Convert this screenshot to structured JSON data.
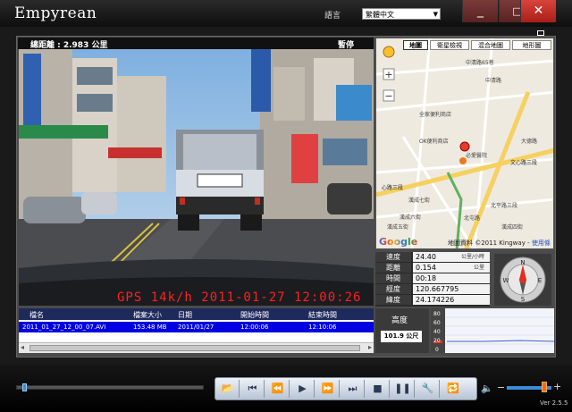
{
  "app": {
    "title": "Empyrean",
    "version": "Ver 2.5.5"
  },
  "language": {
    "label": "語言",
    "selected": "繁體中文"
  },
  "window": {
    "minimize": "_",
    "maximize": "□",
    "close": "✕"
  },
  "video": {
    "total_distance": "總距離 : 2.983 公里",
    "status": "暫停",
    "overlay": "GPS  14k/h  2011-01-27  12:00:26"
  },
  "filelist": {
    "columns": [
      "檔名",
      "檔案大小",
      "日期",
      "開始時間",
      "結束時間"
    ],
    "rows": [
      [
        "2011_01_27_12_00_07.AVI",
        "153.48 MB",
        "2011/01/27",
        "12:00:06",
        "12:10:06"
      ]
    ]
  },
  "map": {
    "tabs": [
      "地圖",
      "衛星檢視",
      "混合地圖",
      "地形圖"
    ],
    "active_tab": "地圖",
    "credit": "地圖資料 ©2011 Kingway -",
    "terms_link": "使用條款",
    "google": "Google",
    "labels": [
      "中清路65巷",
      "中清路",
      "全家便利商店",
      "OK便利商店",
      "大德路",
      "文心路三段",
      "必愛醫院",
      "心路三段",
      "漢成七街",
      "北屯路",
      "北平路三段",
      "漢成六街",
      "漢成五街",
      "漢成四街"
    ]
  },
  "info": {
    "rows": [
      {
        "label": "速度",
        "value": "24.40",
        "unit": "公里/小時"
      },
      {
        "label": "距離",
        "value": "0.154",
        "unit": "公里"
      },
      {
        "label": "時間",
        "value": "00:18",
        "unit": ""
      },
      {
        "label": "經度",
        "value": "120.667795",
        "unit": ""
      },
      {
        "label": "緯度",
        "value": "24.174226",
        "unit": ""
      }
    ]
  },
  "compass": {
    "n": "N",
    "s": "S",
    "e": "E",
    "w": "W"
  },
  "altitude": {
    "label": "高度",
    "value": "101.9 公尺",
    "ticks": [
      "80",
      "60",
      "40",
      "20",
      "0"
    ]
  },
  "playback": {
    "seek_fraction": 0.03,
    "volume_fraction": 0.78
  },
  "colors": {
    "accent": "#3a8ed8",
    "overlay_red": "#ff2020",
    "close_red": "#d8443c",
    "row_select": "#0000e0"
  }
}
